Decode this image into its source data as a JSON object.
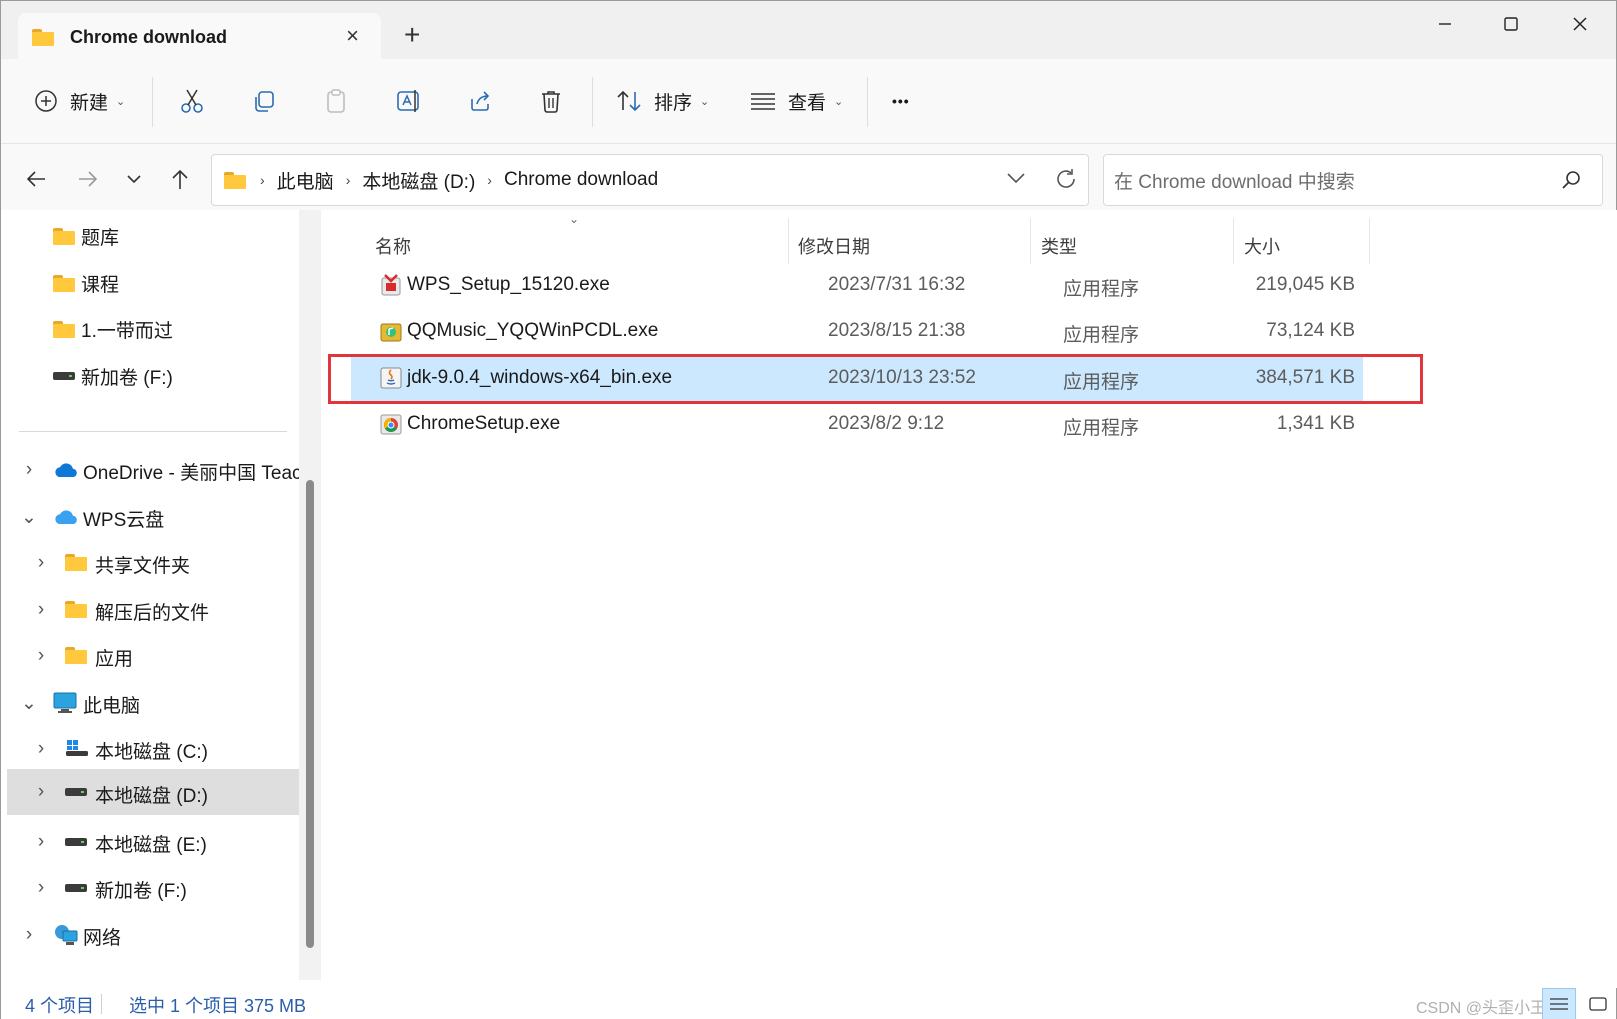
{
  "window": {
    "tab_title": "Chrome download",
    "close_tab_glyph": "×",
    "new_tab_glyph": "+"
  },
  "toolbar": {
    "new_label": "新建",
    "sort_label": "排序",
    "view_label": "查看",
    "more_glyph": "•••"
  },
  "address": {
    "crumbs": [
      "此电脑",
      "本地磁盘 (D:)",
      "Chrome download"
    ],
    "search_placeholder": "在 Chrome download 中搜索"
  },
  "sidebar": {
    "quick": [
      {
        "label": "题库",
        "icon": "folder-icon"
      },
      {
        "label": "课程",
        "icon": "folder-icon"
      },
      {
        "label": "1.一带而过",
        "icon": "folder-icon"
      },
      {
        "label": "新加卷 (F:)",
        "icon": "drive-icon"
      }
    ],
    "tree": [
      {
        "label": "OneDrive - 美丽中国 Teac",
        "icon": "onedrive-icon",
        "expander": "collapsed",
        "level": 0
      },
      {
        "label": "WPS云盘",
        "icon": "wps-cloud-icon",
        "expander": "expanded",
        "level": 0
      },
      {
        "label": "共享文件夹",
        "icon": "shared-folder-icon",
        "expander": "collapsed",
        "level": 1
      },
      {
        "label": "解压后的文件",
        "icon": "folder-icon",
        "expander": "collapsed",
        "level": 1
      },
      {
        "label": "应用",
        "icon": "app-folder-icon",
        "expander": "collapsed",
        "level": 1
      },
      {
        "label": "此电脑",
        "icon": "this-pc-icon",
        "expander": "expanded",
        "level": 0
      },
      {
        "label": "本地磁盘 (C:)",
        "icon": "system-drive-icon",
        "expander": "collapsed",
        "level": 1
      },
      {
        "label": "本地磁盘 (D:)",
        "icon": "drive-icon",
        "expander": "collapsed",
        "level": 1,
        "selected": true
      },
      {
        "label": "本地磁盘 (E:)",
        "icon": "drive-icon",
        "expander": "collapsed",
        "level": 1
      },
      {
        "label": "新加卷 (F:)",
        "icon": "drive-icon",
        "expander": "collapsed",
        "level": 1
      },
      {
        "label": "网络",
        "icon": "network-icon",
        "expander": "collapsed",
        "level": 0
      }
    ]
  },
  "files": {
    "columns": {
      "name": "名称",
      "date": "修改日期",
      "type": "类型",
      "size": "大小"
    },
    "rows": [
      {
        "name": "WPS_Setup_15120.exe",
        "date": "2023/7/31 16:32",
        "type": "应用程序",
        "size": "219,045 KB",
        "icon": "wps-installer-icon"
      },
      {
        "name": "QQMusic_YQQWinPCDL.exe",
        "date": "2023/8/15 21:38",
        "type": "应用程序",
        "size": "73,124 KB",
        "icon": "qqmusic-installer-icon"
      },
      {
        "name": "jdk-9.0.4_windows-x64_bin.exe",
        "date": "2023/10/13 23:52",
        "type": "应用程序",
        "size": "384,571 KB",
        "icon": "java-installer-icon",
        "selected": true
      },
      {
        "name": "ChromeSetup.exe",
        "date": "2023/8/2 9:12",
        "type": "应用程序",
        "size": "1,341 KB",
        "icon": "chrome-installer-icon"
      }
    ]
  },
  "status": {
    "count": "4 个项目",
    "selection": "选中 1 个项目  375 MB",
    "watermark": "CSDN @头歪小王"
  },
  "colors": {
    "accent": "#0067c0",
    "selection": "#cce8ff",
    "highlight_box": "#e0353b",
    "folder": "#ffc83d"
  }
}
